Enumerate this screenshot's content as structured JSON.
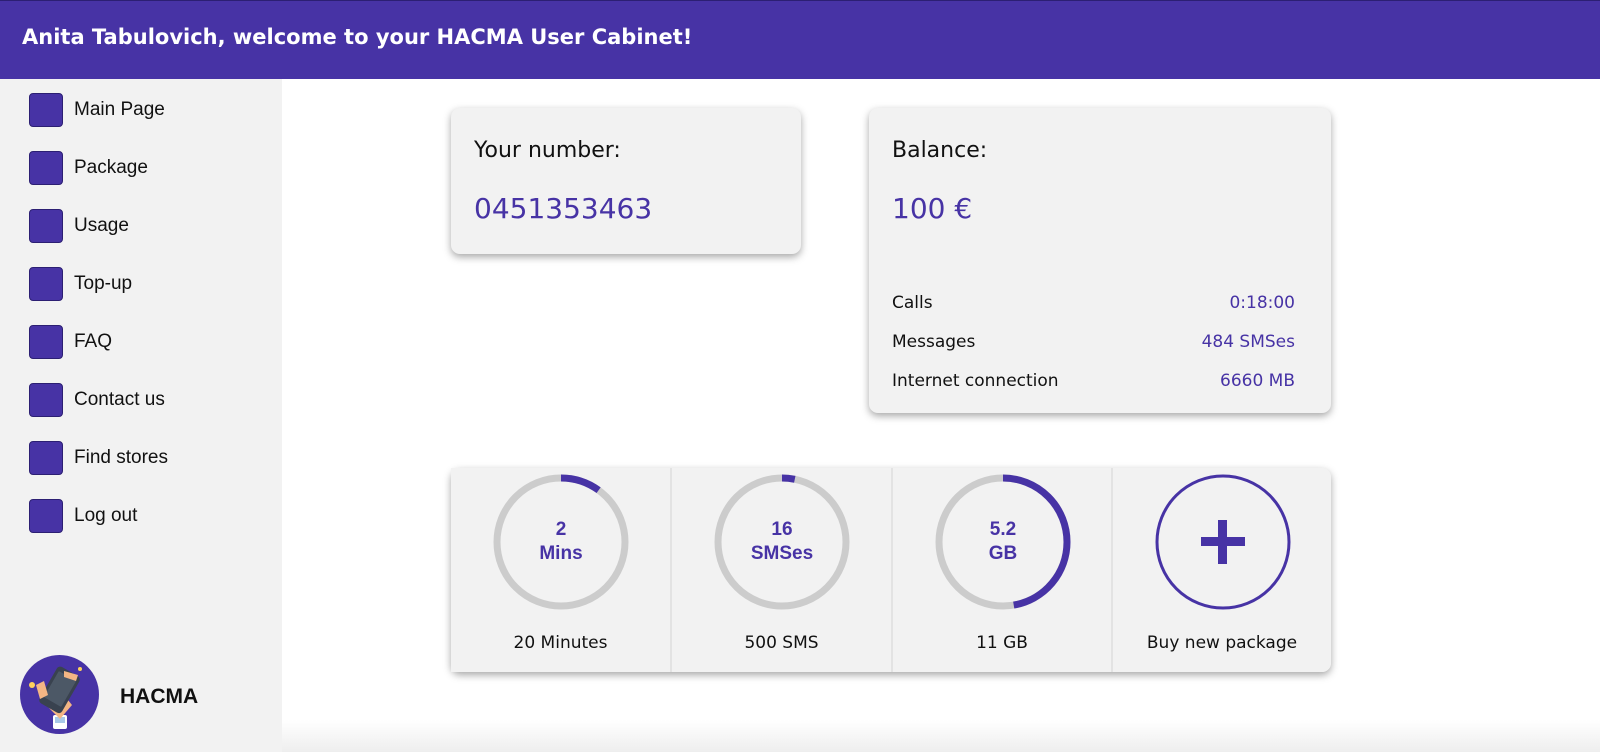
{
  "header": {
    "title": "Anita Tabulovich, welcome to your HACMA User Cabinet!"
  },
  "sidebar": {
    "items": [
      {
        "label": "Main Page",
        "icon": "square-icon"
      },
      {
        "label": "Package",
        "icon": "square-icon"
      },
      {
        "label": "Usage",
        "icon": "square-icon"
      },
      {
        "label": "Top-up",
        "icon": "square-icon"
      },
      {
        "label": "FAQ",
        "icon": "square-icon"
      },
      {
        "label": "Contact us",
        "icon": "square-icon"
      },
      {
        "label": "Find stores",
        "icon": "square-icon"
      },
      {
        "label": "Log out",
        "icon": "square-icon"
      }
    ],
    "brand": {
      "name": "HACMA",
      "logo_icon": "phone-in-hand-icon"
    }
  },
  "number_card": {
    "label": "Your number:",
    "value": "0451353463"
  },
  "balance_card": {
    "label": "Balance:",
    "value": "100 €",
    "rows": [
      {
        "label": "Calls",
        "value": "0:18:00"
      },
      {
        "label": "Messages",
        "value": "484 SMSes"
      },
      {
        "label": "Internet connection",
        "value": "6660 MB"
      }
    ]
  },
  "packages": [
    {
      "value": "2",
      "unit": "Mins",
      "caption": "20 Minutes",
      "fraction": 0.1
    },
    {
      "value": "16",
      "unit": "SMSes",
      "caption": "500 SMS",
      "fraction": 0.032
    },
    {
      "value": "5.2",
      "unit": "GB",
      "caption": "11 GB",
      "fraction": 0.473
    }
  ],
  "buy_package": {
    "caption": "Buy new package",
    "icon": "plus-icon"
  },
  "colors": {
    "accent": "#4733a5",
    "ring_track": "#cccccc",
    "panel": "#f2f2f2"
  }
}
